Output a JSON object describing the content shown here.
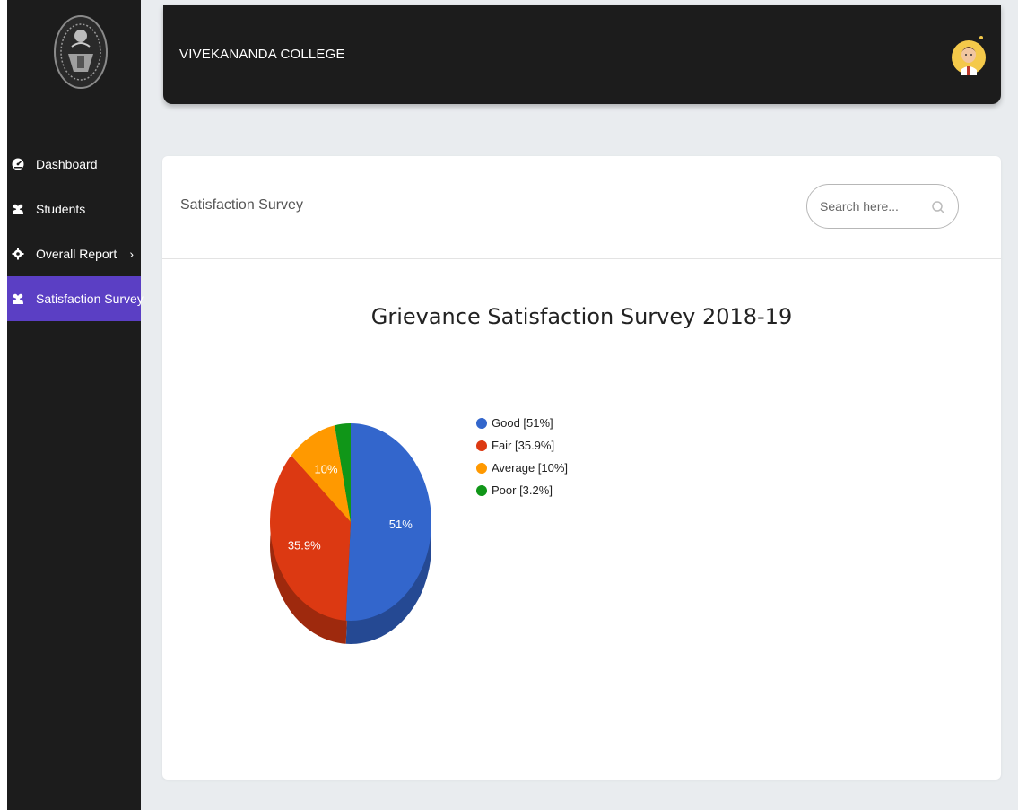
{
  "header": {
    "brand": "VIVEKANANDA COLLEGE"
  },
  "sidebar": {
    "items": [
      {
        "label": "Dashboard",
        "icon": "dashboard-icon",
        "active": false
      },
      {
        "label": "Students",
        "icon": "users-icon",
        "active": false
      },
      {
        "label": "Overall Report",
        "icon": "gear-icon",
        "active": false,
        "has_submenu": true
      },
      {
        "label": "Satisfaction Survey",
        "icon": "users-icon",
        "active": true
      }
    ],
    "submenu_chevron": "›"
  },
  "card": {
    "title": "Satisfaction Survey",
    "search": {
      "placeholder": "Search here..."
    }
  },
  "colors": {
    "sidebar_bg": "#1c1c1c",
    "active_item": "#5b3fc4",
    "good": "#3366cc",
    "fair": "#dc3912",
    "average": "#ff9900",
    "poor": "#109618"
  },
  "chart_data": {
    "type": "pie",
    "title": "Grievance Satisfaction Survey 2018-19",
    "categories": [
      "Good",
      "Fair",
      "Average",
      "Poor"
    ],
    "values": [
      51,
      35.9,
      10,
      3.2
    ],
    "slice_labels": [
      "51%",
      "35.9%",
      "10%",
      ""
    ],
    "legend": [
      "Good [51%]",
      "Fair [35.9%]",
      "Average [10%]",
      "Poor [3.2%]"
    ],
    "legend_placement": "right",
    "style": "3d"
  }
}
